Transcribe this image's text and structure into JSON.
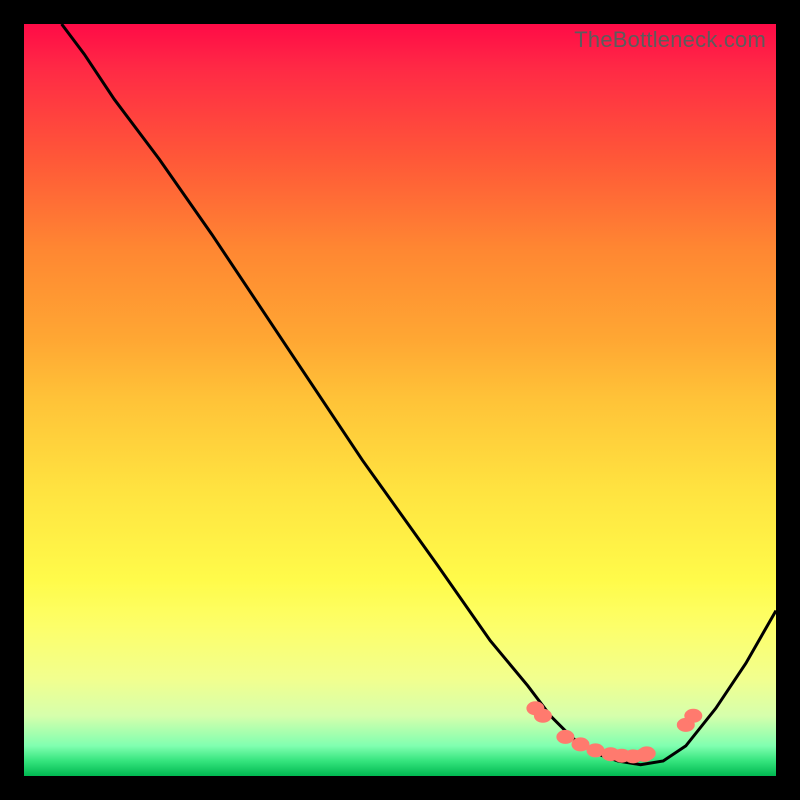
{
  "watermark": "TheBottleneck.com",
  "chart_data": {
    "type": "line",
    "title": "",
    "xlabel": "",
    "ylabel": "",
    "xlim": [
      0,
      100
    ],
    "ylim": [
      0,
      100
    ],
    "series": [
      {
        "name": "bottleneck-curve",
        "x": [
          5,
          8,
          12,
          18,
          25,
          35,
          45,
          55,
          62,
          67,
          70,
          73,
          76,
          79,
          82,
          85,
          88,
          92,
          96,
          100
        ],
        "y": [
          100,
          96,
          90,
          82,
          72,
          57,
          42,
          28,
          18,
          12,
          8,
          5,
          3,
          2,
          1.5,
          2,
          4,
          9,
          15,
          22
        ]
      }
    ],
    "markers": {
      "name": "highlighted-points",
      "color": "#ff7a6e",
      "x": [
        68,
        69,
        72,
        74,
        76,
        78,
        79.5,
        81,
        82.5,
        82.8,
        88,
        89
      ],
      "y": [
        9,
        8,
        5.2,
        4.2,
        3.4,
        2.9,
        2.7,
        2.6,
        2.8,
        3.0,
        6.8,
        8
      ]
    },
    "gradient_stops": [
      {
        "pos": 0.0,
        "color": "#ff0b47"
      },
      {
        "pos": 0.5,
        "color": "#ffc338"
      },
      {
        "pos": 0.87,
        "color": "#f2ff8e"
      },
      {
        "pos": 1.0,
        "color": "#00b851"
      }
    ]
  }
}
